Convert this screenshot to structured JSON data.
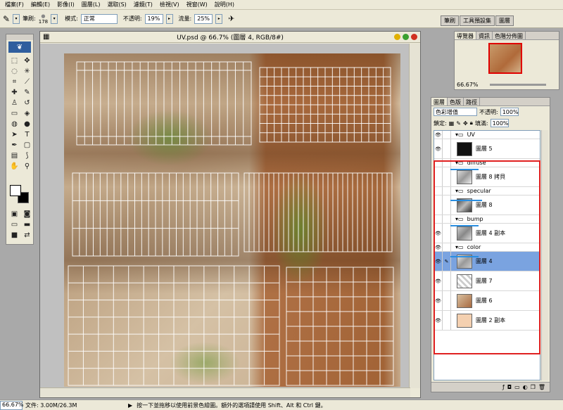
{
  "menu": [
    "檔案(F)",
    "編輯(E)",
    "影像(I)",
    "圖層(L)",
    "選取(S)",
    "濾鏡(T)",
    "檢視(V)",
    "視窗(W)",
    "說明(H)"
  ],
  "options": {
    "brush_label": "筆刷:",
    "brush_size": "178",
    "mode_label": "模式:",
    "mode_value": "正常",
    "opacity_label": "不透明:",
    "opacity_value": "19%",
    "flow_label": "流量:",
    "flow_value": "25%",
    "tabs": [
      "筆刷",
      "工具預設集",
      "圖層"
    ]
  },
  "document": {
    "title": "UV.psd @ 66.7% (圖層 4, RGB/8#)"
  },
  "navigator": {
    "tabs": [
      "導覽器",
      "資訊",
      "色階分佈圖"
    ],
    "zoom": "66.67%"
  },
  "layers_panel": {
    "tabs": [
      "圖層",
      "色版",
      "路徑"
    ],
    "blend_mode": "色彩增值",
    "opacity_label": "不透明:",
    "opacity_value": "100%",
    "lock_label": "鎖定:",
    "fill_label": "填滿:",
    "fill_value": "100%",
    "layers": [
      {
        "kind": "group",
        "name": "UV"
      },
      {
        "kind": "layer",
        "name": "圖層 5"
      },
      {
        "kind": "group",
        "name": "diffuse"
      },
      {
        "kind": "layer",
        "name": "圖層 8 拷貝"
      },
      {
        "kind": "group",
        "name": "specular"
      },
      {
        "kind": "layer",
        "name": "圖層 8"
      },
      {
        "kind": "group",
        "name": "bump"
      },
      {
        "kind": "layer",
        "name": "圖層 4 副本"
      },
      {
        "kind": "group",
        "name": "color"
      },
      {
        "kind": "layer",
        "name": "圖層 4"
      },
      {
        "kind": "layer",
        "name": "圖層 7"
      },
      {
        "kind": "layer",
        "name": "圖層 6"
      },
      {
        "kind": "layer",
        "name": "圖層 2 副本"
      }
    ]
  },
  "status": {
    "zoom": "66.67%",
    "doc": "文件: 3.00M/26.3M",
    "hint": "按一下並拖移以使用前景色繪圖。額外的選項請使用 Shift、Alt 和 Ctrl 鍵。"
  },
  "colors": {
    "selection": "#7aa3e0",
    "annotation_red": "#e02020",
    "annotation_blue": "#2a8ee0"
  }
}
